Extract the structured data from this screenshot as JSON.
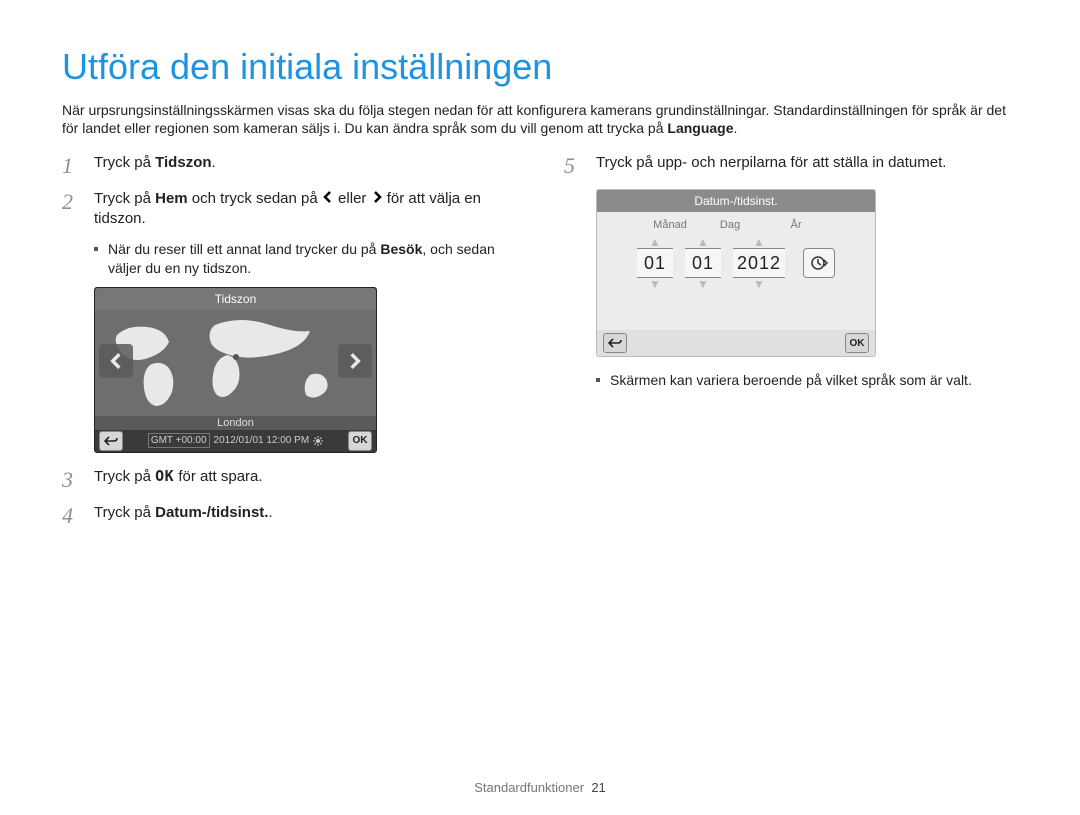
{
  "title": "Utföra den initiala inställningen",
  "intro_p1": "När urpsrungsinställningsskärmen visas ska du följa stegen nedan för att konfigurera kamerans grundinställningar. Standardinställningen för språk är det för landet eller regionen som kameran säljs i. Du kan ändra språk som du vill genom att trycka på ",
  "intro_bold": "Language",
  "intro_tail": ".",
  "step1_a": "Tryck på ",
  "step1_b": "Tidszon",
  "step1_c": ".",
  "step2_a": "Tryck på ",
  "step2_b": "Hem",
  "step2_c": " och tryck sedan på ",
  "step2_d": " eller ",
  "step2_e": " för att välja en tidszon.",
  "step2_note_a": "När du reser till ett annat land trycker du på ",
  "step2_note_b": "Besök",
  "step2_note_c": ", och sedan väljer du en ny tidszon.",
  "tz": {
    "title": "Tidszon",
    "location": "London",
    "gmt": "GMT +00:00",
    "datetime": "2012/01/01 12:00 PM",
    "ok": "OK"
  },
  "step3_a": "Tryck på ",
  "step3_ok": "OK",
  "step3_c": " för att spara.",
  "step4_a": "Tryck på ",
  "step4_b": "Datum-/tidsinst.",
  "step4_c": ".",
  "step5": "Tryck på upp- och nerpilarna för att ställa in datumet.",
  "dt": {
    "title": "Datum-/tidsinst.",
    "l_month": "Månad",
    "l_day": "Dag",
    "l_year": "År",
    "month": "01",
    "day": "01",
    "year": "2012",
    "ok": "OK"
  },
  "dt_note": "Skärmen kan variera beroende på vilket språk som är valt.",
  "footer_label": "Standardfunktioner",
  "page_num": "21",
  "nums": {
    "1": "1",
    "2": "2",
    "3": "3",
    "4": "4",
    "5": "5"
  }
}
